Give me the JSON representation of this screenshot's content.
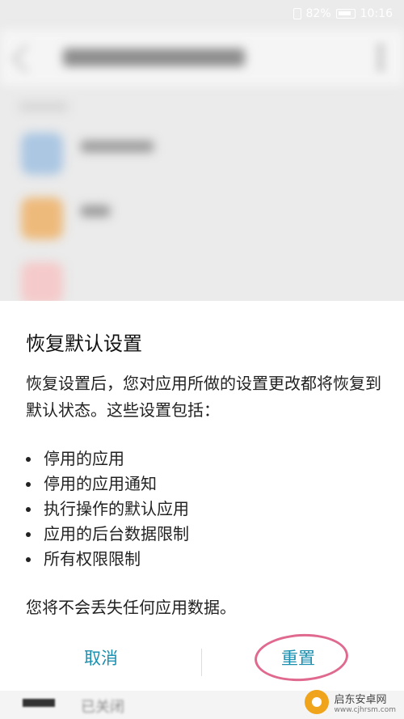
{
  "status_bar": {
    "battery_percent": "82%",
    "time": "10:16"
  },
  "dialog": {
    "title": "恢复默认设置",
    "body": "恢复设置后，您对应用所做的设置更改都将恢复到默认状态。这些设置包括：",
    "items": [
      "停用的应用",
      "停用的应用通知",
      "执行操作的默认应用",
      "应用的后台数据限制",
      "所有权限限制"
    ],
    "footer": "您将不会丢失任何应用数据。",
    "cancel_label": "取消",
    "reset_label": "重置"
  },
  "background": {
    "bottom_text": "已关闭"
  },
  "watermark": {
    "brand": "启东安卓网",
    "site": "www.cjhrsm.com"
  },
  "colors": {
    "button_text": "#1b8fb0",
    "highlight_ring": "#e06a8f"
  }
}
